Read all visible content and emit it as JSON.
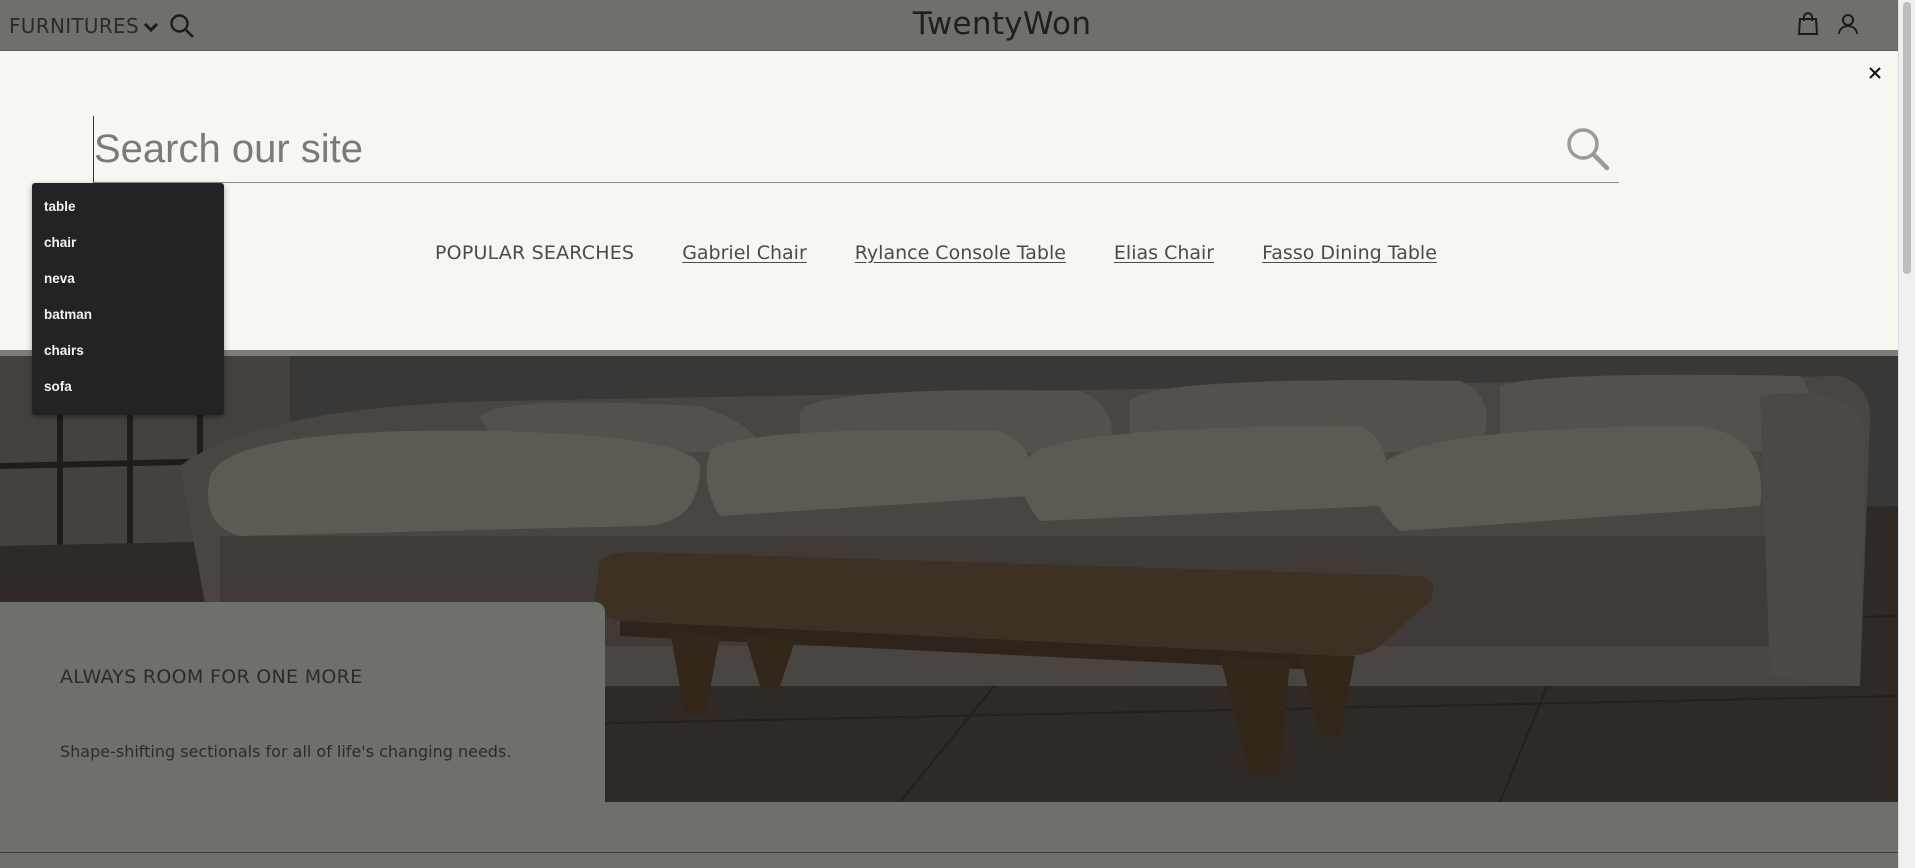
{
  "header": {
    "menu_label": "FURNITURES",
    "brand": "TwentyWon"
  },
  "search": {
    "placeholder": "Search our site",
    "value": ""
  },
  "popular": {
    "heading": "POPULAR SEARCHES",
    "links": [
      "Gabriel Chair",
      "Rylance Console Table",
      "Elias Chair",
      "Fasso Dining Table"
    ]
  },
  "suggestions": [
    "table",
    "chair",
    "neva",
    "batman",
    "chairs",
    "sofa"
  ],
  "hero": {
    "title": "ALWAYS ROOM FOR ONE MORE",
    "subtitle": "Shape-shifting sectionals for all of life's changing needs."
  },
  "colors": {
    "overlay_dim": "#6f706b",
    "search_panel": "#f7f6f0",
    "dropdown": "#232326"
  },
  "icons": [
    "chevron-down-icon",
    "search-icon",
    "bag-icon",
    "user-icon",
    "close-icon"
  ]
}
